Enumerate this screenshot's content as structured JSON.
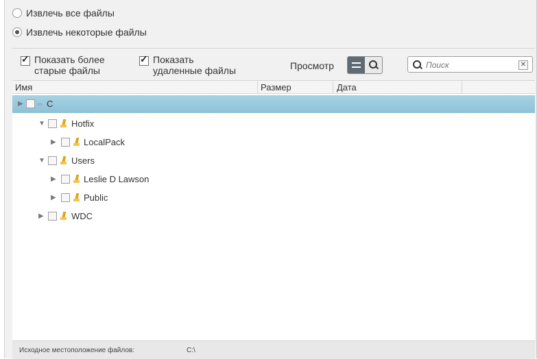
{
  "extract": {
    "all_files_label": "Извлечь все файлы",
    "some_files_label": "Извлечь некоторые файлы",
    "selected": "some"
  },
  "toolbar": {
    "show_older_line1": "Показать более",
    "show_older_line2": "старые файлы",
    "show_deleted_line1": "Показать",
    "show_deleted_line2": "удаленные файлы",
    "view_label": "Просмотр",
    "search_placeholder": "Поиск"
  },
  "columns": {
    "name": "Имя",
    "size": "Размер",
    "date": "Дата"
  },
  "tree": [
    {
      "label": "C",
      "type": "drive",
      "expanded": false,
      "selected": true
    },
    {
      "label": "Hotfix",
      "type": "folder",
      "expanded": true
    },
    {
      "label": "LocalPack",
      "type": "folder",
      "expanded": false
    },
    {
      "label": "Users",
      "type": "folder",
      "expanded": true
    },
    {
      "label": "Leslie D Lawson",
      "type": "user-folder",
      "expanded": false
    },
    {
      "label": "Public",
      "type": "folder",
      "expanded": false
    },
    {
      "label": "WDC",
      "type": "folder",
      "expanded": false
    }
  ],
  "status": {
    "source_label": "Исходное местоположение файлов:",
    "source_value": "C:\\"
  },
  "colors": {
    "selected_row": "#9ecadd",
    "folder": "#e3a21a",
    "toggle_active": "#5f6a73"
  }
}
